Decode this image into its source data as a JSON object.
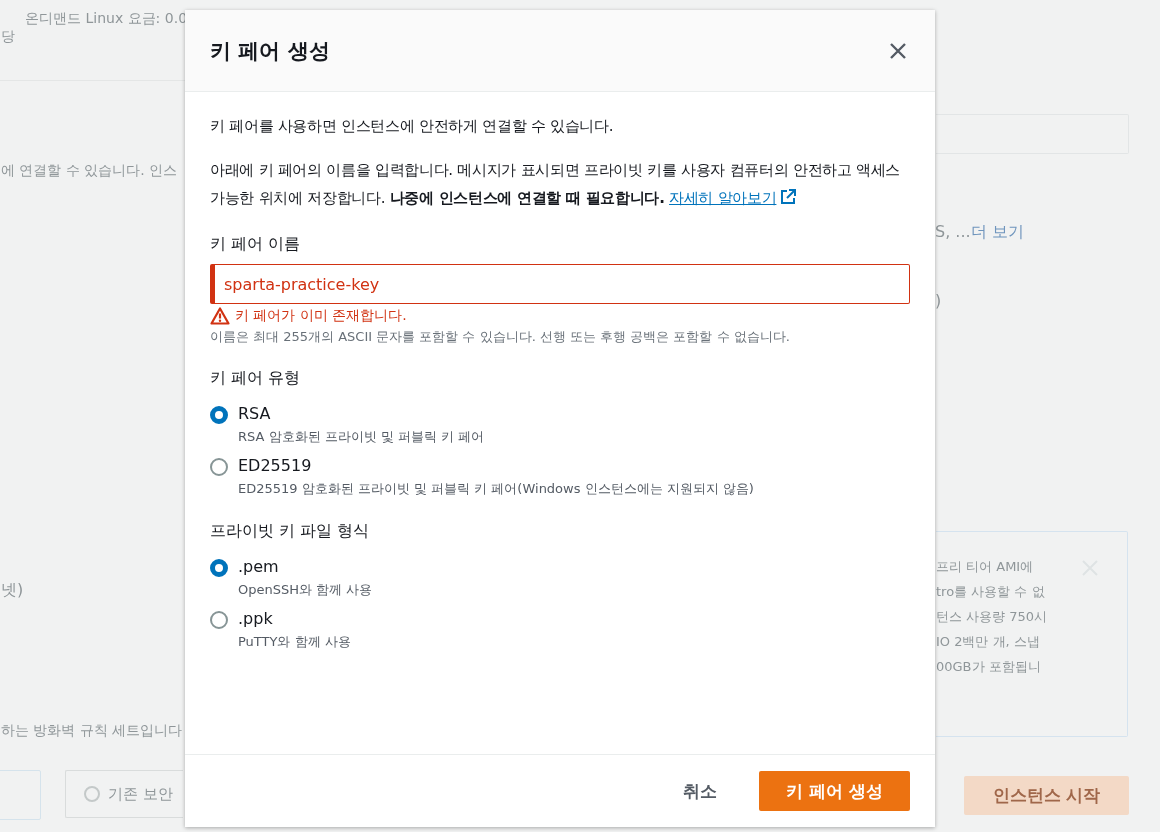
{
  "background": {
    "pricing": "온디맨드 Linux 요금: 0.0",
    "fragment_top": "당",
    "connect_text": "에 연결할 수 있습니다. 인스",
    "more_text": "S, ...",
    "more_link": "더 보기",
    "paren_text": ")",
    "subnet_text": "넷)",
    "firewall_text": "하는 방화벽 규칙 세트입니다",
    "existing_option": {
      "label": "기존 보안",
      "selected": false
    },
    "info_box": {
      "lines": [
        "프리 티어 AMI에",
        "tro를 사용할 수 없",
        "턴스 사용량 750시",
        "IO 2백만 개, 스냅",
        "00GB가 포함됩니"
      ]
    },
    "launch_button": {
      "label": "인스턴스 시작",
      "disabled": true
    }
  },
  "modal": {
    "title": "키 페어 생성",
    "intro": "키 페어를 사용하면 인스턴스에 안전하게 연결할 수 있습니다.",
    "description": "아래에 키 페어의 이름을 입력합니다. 메시지가 표시되면 프라이빗 키를 사용자 컴퓨터의 안전하고 액세스 가능한 위치에 저장합니다. **나중에 인스턴스에 연결할 때 필요합니다.**",
    "learn_more": "자세히 알아보기",
    "name_field": {
      "label": "키 페어 이름",
      "value": "sparta-practice-key",
      "error": "키 페어가 이미 존재합니다.",
      "hint": "이름은 최대 255개의 ASCII 문자를 포함할 수 있습니다. 선행 또는 후행 공백은 포함할 수 없습니다."
    },
    "type_group": {
      "label": "키 페어 유형",
      "options": [
        {
          "label": "RSA",
          "description": "RSA 암호화된 프라이빗 및 퍼블릭 키 페어",
          "selected": true
        },
        {
          "label": "ED25519",
          "description": "ED25519 암호화된 프라이빗 및 퍼블릭 키 페어(Windows 인스턴스에는 지원되지 않음)",
          "selected": false
        }
      ]
    },
    "format_group": {
      "label": "프라이빗 키 파일 형식",
      "options": [
        {
          "label": ".pem",
          "description": "OpenSSH와 함께 사용",
          "selected": true
        },
        {
          "label": ".ppk",
          "description": "PuTTY와 함께 사용",
          "selected": false
        }
      ]
    },
    "cancel_button": "취소",
    "create_button": "키 페어 생성"
  }
}
